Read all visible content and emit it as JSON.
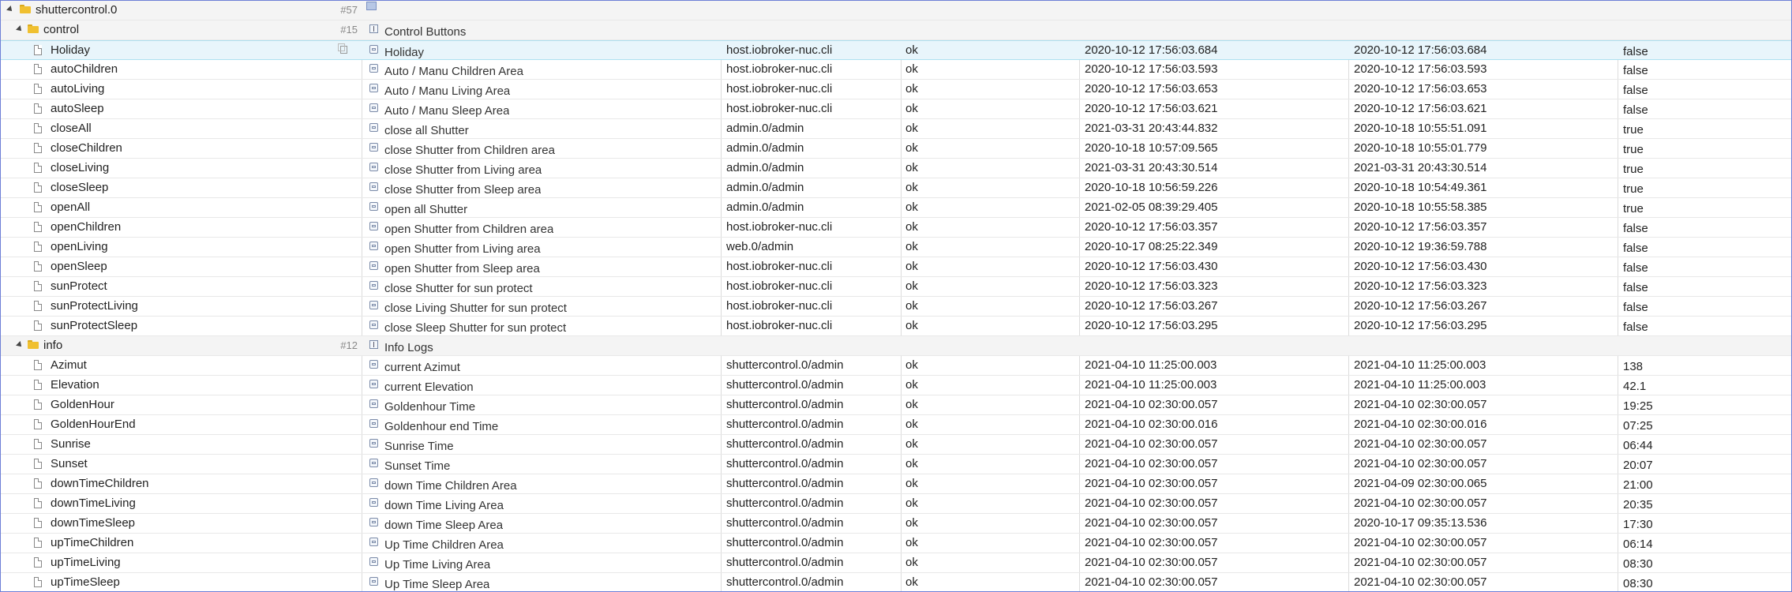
{
  "root": {
    "name": "shuttercontrol.0",
    "count": "#57"
  },
  "groups": [
    {
      "name": "control",
      "count": "#15",
      "description": "Control Buttons",
      "rows": [
        {
          "name": "Holiday",
          "description": "Holiday",
          "from": "host.iobroker-nuc.cli",
          "ack": "ok",
          "ts": "2020-10-12 17:56:03.684",
          "lc": "2020-10-12 17:56:03.684",
          "value": "false",
          "selected": true
        },
        {
          "name": "autoChildren",
          "description": "Auto / Manu Children Area",
          "from": "host.iobroker-nuc.cli",
          "ack": "ok",
          "ts": "2020-10-12 17:56:03.593",
          "lc": "2020-10-12 17:56:03.593",
          "value": "false"
        },
        {
          "name": "autoLiving",
          "description": "Auto / Manu Living Area",
          "from": "host.iobroker-nuc.cli",
          "ack": "ok",
          "ts": "2020-10-12 17:56:03.653",
          "lc": "2020-10-12 17:56:03.653",
          "value": "false"
        },
        {
          "name": "autoSleep",
          "description": "Auto / Manu Sleep Area",
          "from": "host.iobroker-nuc.cli",
          "ack": "ok",
          "ts": "2020-10-12 17:56:03.621",
          "lc": "2020-10-12 17:56:03.621",
          "value": "false"
        },
        {
          "name": "closeAll",
          "description": "close all Shutter",
          "from": "admin.0/admin",
          "ack": "ok",
          "ts": "2021-03-31 20:43:44.832",
          "lc": "2020-10-18 10:55:51.091",
          "value": "true"
        },
        {
          "name": "closeChildren",
          "description": "close Shutter from Children area",
          "from": "admin.0/admin",
          "ack": "ok",
          "ts": "2020-10-18 10:57:09.565",
          "lc": "2020-10-18 10:55:01.779",
          "value": "true"
        },
        {
          "name": "closeLiving",
          "description": "close Shutter from Living area",
          "from": "admin.0/admin",
          "ack": "ok",
          "ts": "2021-03-31 20:43:30.514",
          "lc": "2021-03-31 20:43:30.514",
          "value": "true"
        },
        {
          "name": "closeSleep",
          "description": "close Shutter from Sleep area",
          "from": "admin.0/admin",
          "ack": "ok",
          "ts": "2020-10-18 10:56:59.226",
          "lc": "2020-10-18 10:54:49.361",
          "value": "true"
        },
        {
          "name": "openAll",
          "description": "open all Shutter",
          "from": "admin.0/admin",
          "ack": "ok",
          "ts": "2021-02-05 08:39:29.405",
          "lc": "2020-10-18 10:55:58.385",
          "value": "true"
        },
        {
          "name": "openChildren",
          "description": "open Shutter from Children area",
          "from": "host.iobroker-nuc.cli",
          "ack": "ok",
          "ts": "2020-10-12 17:56:03.357",
          "lc": "2020-10-12 17:56:03.357",
          "value": "false"
        },
        {
          "name": "openLiving",
          "description": "open Shutter from Living area",
          "from": "web.0/admin",
          "ack": "ok",
          "ts": "2020-10-17 08:25:22.349",
          "lc": "2020-10-12 19:36:59.788",
          "value": "false"
        },
        {
          "name": "openSleep",
          "description": "open Shutter from Sleep area",
          "from": "host.iobroker-nuc.cli",
          "ack": "ok",
          "ts": "2020-10-12 17:56:03.430",
          "lc": "2020-10-12 17:56:03.430",
          "value": "false"
        },
        {
          "name": "sunProtect",
          "description": "close Shutter for sun protect",
          "from": "host.iobroker-nuc.cli",
          "ack": "ok",
          "ts": "2020-10-12 17:56:03.323",
          "lc": "2020-10-12 17:56:03.323",
          "value": "false"
        },
        {
          "name": "sunProtectLiving",
          "description": "close Living Shutter for sun protect",
          "from": "host.iobroker-nuc.cli",
          "ack": "ok",
          "ts": "2020-10-12 17:56:03.267",
          "lc": "2020-10-12 17:56:03.267",
          "value": "false"
        },
        {
          "name": "sunProtectSleep",
          "description": "close Sleep Shutter for sun protect",
          "from": "host.iobroker-nuc.cli",
          "ack": "ok",
          "ts": "2020-10-12 17:56:03.295",
          "lc": "2020-10-12 17:56:03.295",
          "value": "false"
        }
      ]
    },
    {
      "name": "info",
      "count": "#12",
      "description": "Info Logs",
      "rows": [
        {
          "name": "Azimut",
          "description": "current Azimut",
          "from": "shuttercontrol.0/admin",
          "ack": "ok",
          "ts": "2021-04-10 11:25:00.003",
          "lc": "2021-04-10 11:25:00.003",
          "value": "138"
        },
        {
          "name": "Elevation",
          "description": "current Elevation",
          "from": "shuttercontrol.0/admin",
          "ack": "ok",
          "ts": "2021-04-10 11:25:00.003",
          "lc": "2021-04-10 11:25:00.003",
          "value": "42.1"
        },
        {
          "name": "GoldenHour",
          "description": "Goldenhour Time",
          "from": "shuttercontrol.0/admin",
          "ack": "ok",
          "ts": "2021-04-10 02:30:00.057",
          "lc": "2021-04-10 02:30:00.057",
          "value": "19:25"
        },
        {
          "name": "GoldenHourEnd",
          "description": "Goldenhour end Time",
          "from": "shuttercontrol.0/admin",
          "ack": "ok",
          "ts": "2021-04-10 02:30:00.016",
          "lc": "2021-04-10 02:30:00.016",
          "value": "07:25"
        },
        {
          "name": "Sunrise",
          "description": "Sunrise Time",
          "from": "shuttercontrol.0/admin",
          "ack": "ok",
          "ts": "2021-04-10 02:30:00.057",
          "lc": "2021-04-10 02:30:00.057",
          "value": "06:44"
        },
        {
          "name": "Sunset",
          "description": "Sunset Time",
          "from": "shuttercontrol.0/admin",
          "ack": "ok",
          "ts": "2021-04-10 02:30:00.057",
          "lc": "2021-04-10 02:30:00.057",
          "value": "20:07"
        },
        {
          "name": "downTimeChildren",
          "description": "down Time Children Area",
          "from": "shuttercontrol.0/admin",
          "ack": "ok",
          "ts": "2021-04-10 02:30:00.057",
          "lc": "2021-04-09 02:30:00.065",
          "value": "21:00"
        },
        {
          "name": "downTimeLiving",
          "description": "down Time Living Area",
          "from": "shuttercontrol.0/admin",
          "ack": "ok",
          "ts": "2021-04-10 02:30:00.057",
          "lc": "2021-04-10 02:30:00.057",
          "value": "20:35"
        },
        {
          "name": "downTimeSleep",
          "description": "down Time Sleep Area",
          "from": "shuttercontrol.0/admin",
          "ack": "ok",
          "ts": "2021-04-10 02:30:00.057",
          "lc": "2020-10-17 09:35:13.536",
          "value": "17:30"
        },
        {
          "name": "upTimeChildren",
          "description": "Up Time Children Area",
          "from": "shuttercontrol.0/admin",
          "ack": "ok",
          "ts": "2021-04-10 02:30:00.057",
          "lc": "2021-04-10 02:30:00.057",
          "value": "06:14"
        },
        {
          "name": "upTimeLiving",
          "description": "Up Time Living Area",
          "from": "shuttercontrol.0/admin",
          "ack": "ok",
          "ts": "2021-04-10 02:30:00.057",
          "lc": "2021-04-10 02:30:00.057",
          "value": "08:30"
        },
        {
          "name": "upTimeSleep",
          "description": "Up Time Sleep Area",
          "from": "shuttercontrol.0/admin",
          "ack": "ok",
          "ts": "2021-04-10 02:30:00.057",
          "lc": "2021-04-10 02:30:00.057",
          "value": "08:30"
        }
      ]
    }
  ]
}
